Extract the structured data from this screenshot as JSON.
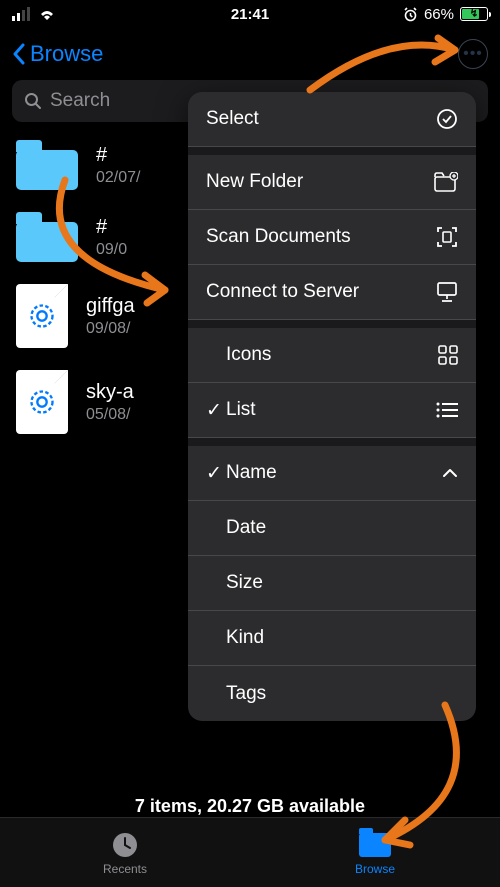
{
  "status": {
    "time": "21:41",
    "batteryPct": "66%"
  },
  "nav": {
    "back": "Browse"
  },
  "search": {
    "placeholder": "Search"
  },
  "items": [
    {
      "name": "#",
      "date": "02/07/"
    },
    {
      "name": "#",
      "date": "09/0"
    },
    {
      "name": "giffga",
      "date": "09/08/"
    },
    {
      "name": "sky-a",
      "date": "05/08/"
    }
  ],
  "menu": {
    "select": "Select",
    "newFolder": "New Folder",
    "scan": "Scan Documents",
    "connect": "Connect to Server",
    "icons": "Icons",
    "list": "List",
    "name": "Name",
    "date": "Date",
    "size": "Size",
    "kind": "Kind",
    "tags": "Tags"
  },
  "footer": {
    "info": "7 items, 20.27 GB available"
  },
  "tabs": {
    "recents": "Recents",
    "browse": "Browse"
  }
}
